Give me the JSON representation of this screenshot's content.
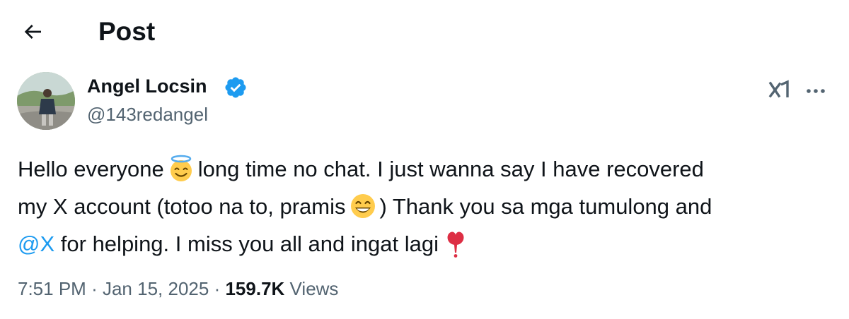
{
  "header": {
    "title": "Post",
    "back_icon": "arrow-left-icon"
  },
  "author": {
    "name": "Angel Locsin",
    "handle": "@143redangel",
    "verified_icon": "verified-badge-icon",
    "verified_color": "#1d9bf0"
  },
  "actions": {
    "grok_icon": "grok-icon",
    "more_icon": "more-horizontal-icon"
  },
  "post": {
    "line1_a": "Hello everyone",
    "emoji1": "smiling-face-with-halo",
    "line1_b": "long time no chat. I just wanna say I have recovered",
    "line2_a": "my X account (totoo na to, pramis",
    "emoji2": "grinning-face-with-smiling-eyes",
    "line2_b": ") Thank you sa mga tumulong and",
    "mention": "@X",
    "line3_a": "for helping. I miss you all and ingat lagi",
    "emoji3": "heavy-heart-exclamation"
  },
  "meta": {
    "time": "7:51 PM",
    "separator": "·",
    "date": "Jan 15, 2025",
    "views_count": "159.7K",
    "views_label": "Views"
  },
  "colors": {
    "text_primary": "#0f1419",
    "text_secondary": "#536471",
    "accent": "#1d9bf0",
    "emoji_yellow": "#ffcc4d",
    "heart_red": "#dd2e44"
  }
}
